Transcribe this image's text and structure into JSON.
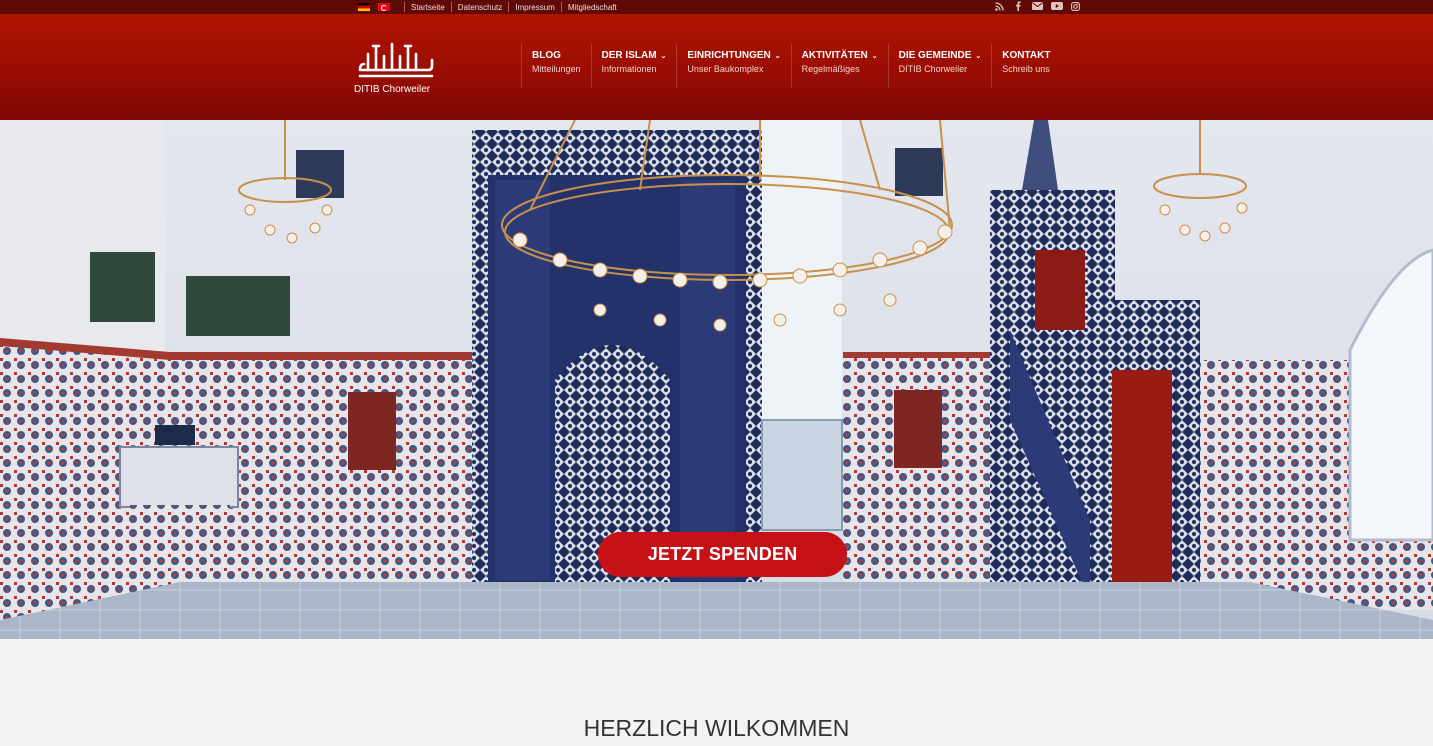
{
  "topbar": {
    "flags": [
      "de",
      "tr"
    ],
    "links": [
      "Startseite",
      "Datenschutz",
      "Impressum",
      "Mitgliedschaft"
    ],
    "social_icons": [
      "rss-icon",
      "facebook-icon",
      "envelope-icon",
      "youtube-icon",
      "instagram-icon"
    ]
  },
  "logo": {
    "text": "DITIB Chorweiler"
  },
  "nav": [
    {
      "title": "BLOG",
      "subtitle": "Mitteilungen",
      "dropdown": false
    },
    {
      "title": "DER ISLAM",
      "subtitle": "Informationen",
      "dropdown": true
    },
    {
      "title": "EINRICHTUNGEN",
      "subtitle": "Unser Baukomplex",
      "dropdown": true
    },
    {
      "title": "AKTIVITÄTEN",
      "subtitle": "Regelmäßiges",
      "dropdown": true
    },
    {
      "title": "DIE GEMEINDE",
      "subtitle": "DITIB Chorweiler",
      "dropdown": true
    },
    {
      "title": "KONTAKT",
      "subtitle": "Schreib uns",
      "dropdown": false
    }
  ],
  "hero": {
    "cta_label": "JETZT SPENDEN"
  },
  "welcome": {
    "heading": "HERZLICH WILKOMMEN"
  },
  "colors": {
    "brand_red": "#b01400",
    "cta_red": "#c81117",
    "topbar": "#5e0a06"
  }
}
